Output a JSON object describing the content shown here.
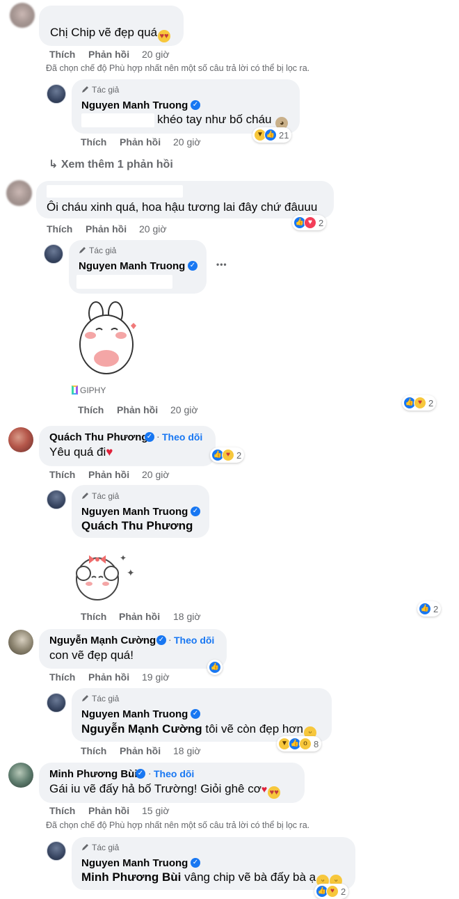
{
  "labels": {
    "like": "Thích",
    "reply": "Phản hồi",
    "author_tag": "Tác giả",
    "follow": "Theo dõi",
    "dot": "·",
    "filter_notice": "Đã chọn chế độ Phù hợp nhất nên một số câu trả lời có thể bị lọc ra.",
    "see_more": "Xem thêm 1 phản hồi",
    "giphy": "GIPHY",
    "more": "•••"
  },
  "colors": {
    "link_blue": "#1877f2",
    "muted": "#65676b",
    "bubble": "#f0f2f5"
  },
  "comments": [
    {
      "author": "",
      "text": "Chị Chip vẽ đẹp quá",
      "text_emoji": "heart-eyes",
      "time": "20 giờ",
      "reply": {
        "author": "Nguyen Manh Truong",
        "text": "khéo tay như bố cháu",
        "text_emoji": "monkey",
        "time": "20 giờ",
        "reactions": [
          "haha",
          "like"
        ],
        "reaction_count": "21"
      }
    },
    {
      "author": "",
      "text": "Ôi cháu xinh quá, hoa hậu tương lai đây chứ đâuuu",
      "time": "20 giờ",
      "reactions": [
        "like",
        "love"
      ],
      "reaction_count": "2",
      "reply": {
        "author": "Nguyen Manh Truong",
        "sticker": "bunny-sticker",
        "time": "20 giờ",
        "reactions": [
          "like",
          "care"
        ],
        "reaction_count": "2"
      }
    },
    {
      "author": "Quách Thu Phương",
      "text": "Yêu quá đi",
      "text_emoji": "red-heart",
      "time": "20 giờ",
      "reactions": [
        "like",
        "care"
      ],
      "reaction_count": "2",
      "reply": {
        "author": "Nguyen Manh Truong",
        "mention": "Quách Thu Phương",
        "sticker": "sheep-sticker",
        "time": "18 giờ",
        "reactions": [
          "like"
        ],
        "reaction_count": "2"
      }
    },
    {
      "author": "Nguyễn Mạnh Cường",
      "text": "con vẽ đẹp quá!",
      "time": "19 giờ",
      "reactions": [
        "like"
      ],
      "reply": {
        "author": "Nguyen Manh Truong",
        "mention": "Nguyễn Mạnh Cường",
        "text": "tôi vẽ còn đẹp hơn",
        "text_emoji": "grin",
        "time": "18 giờ",
        "reactions": [
          "haha",
          "like",
          "wow"
        ],
        "reaction_count": "8"
      }
    },
    {
      "author": "Minh Phương Bùi",
      "text": "Gái iu vẽ đấy hả bố Trường! Giỏi ghê cơ",
      "text_emoji": "hearts-heart-eyes",
      "time": "15 giờ",
      "reply": {
        "author": "Nguyen Manh Truong",
        "mention": "Minh Phương Bùi",
        "text": "vâng chip vẽ bà đấy bà ạ",
        "text_emoji": "smile-smile",
        "reactions": [
          "like",
          "care"
        ],
        "reaction_count": "2"
      }
    }
  ]
}
